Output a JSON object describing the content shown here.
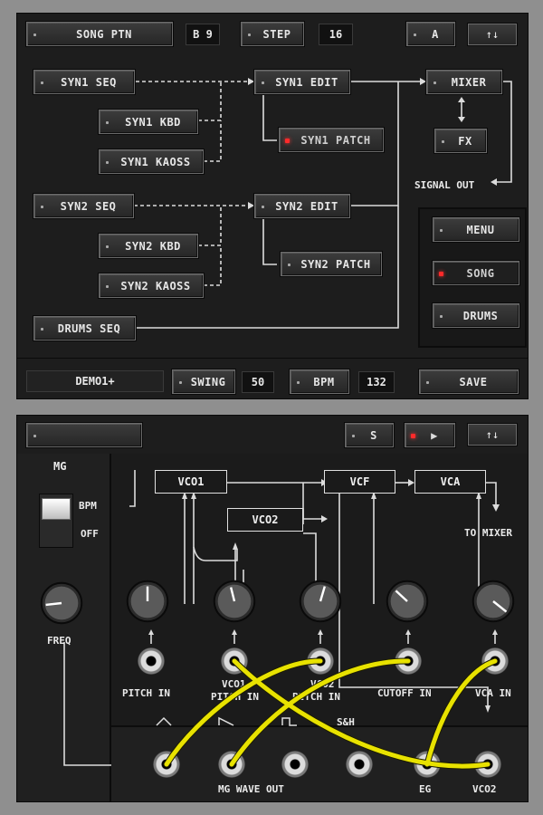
{
  "seq_panel": {
    "top": {
      "song_ptn": "SONG PTN",
      "pattern_value": "B 9",
      "step": "STEP",
      "step_value": "16",
      "track": "A",
      "updown": "↑↓"
    },
    "nodes": {
      "syn1_seq": "SYN1 SEQ",
      "syn1_kbd": "SYN1 KBD",
      "syn1_kaoss": "SYN1 KAOSS",
      "syn1_edit": "SYN1 EDIT",
      "syn1_patch": "SYN1 PATCH",
      "syn2_seq": "SYN2 SEQ",
      "syn2_kbd": "SYN2 KBD",
      "syn2_kaoss": "SYN2 KAOSS",
      "syn2_edit": "SYN2 EDIT",
      "syn2_patch": "SYN2 PATCH",
      "drums_seq": "DRUMS SEQ",
      "mixer": "MIXER",
      "fx": "FX",
      "signal_out": "SIGNAL OUT"
    },
    "menu": {
      "menu": "MENU",
      "song": "SONG",
      "drums": "DRUMS"
    },
    "bottom": {
      "song_name": "DEMO1+",
      "swing": "SWING",
      "swing_value": "50",
      "bpm": "BPM",
      "bpm_value": "132",
      "save": "SAVE"
    }
  },
  "synth_panel": {
    "top": {
      "name_field": "",
      "mode": "S",
      "updown": "↑↓"
    },
    "mg": {
      "title": "MG",
      "bpm": "BPM",
      "off": "OFF",
      "freq": "FREQ"
    },
    "modules": {
      "vco1": "VCO1",
      "vco2": "VCO2",
      "vcf": "VCF",
      "vca": "VCA",
      "to_mixer": "TO MIXER"
    },
    "inputs": {
      "pitch_in": "PITCH IN",
      "vco1_pitch_in_a": "VCO1",
      "vco1_pitch_in_b": "PITCH IN",
      "vco2_pitch_in_a": "VCO2",
      "vco2_pitch_in_b": "PITCH IN",
      "cutoff_in": "CUTOFF IN",
      "vca_in": "VCA IN"
    },
    "outputs": {
      "mg_wave_out": "MG WAVE OUT",
      "sample_hold": "S&H",
      "eg": "EG",
      "vco2": "VCO2"
    },
    "colors": {
      "cable": "#e8e200",
      "panel": "#1d1d1d",
      "led": "#ff2a2a"
    }
  }
}
